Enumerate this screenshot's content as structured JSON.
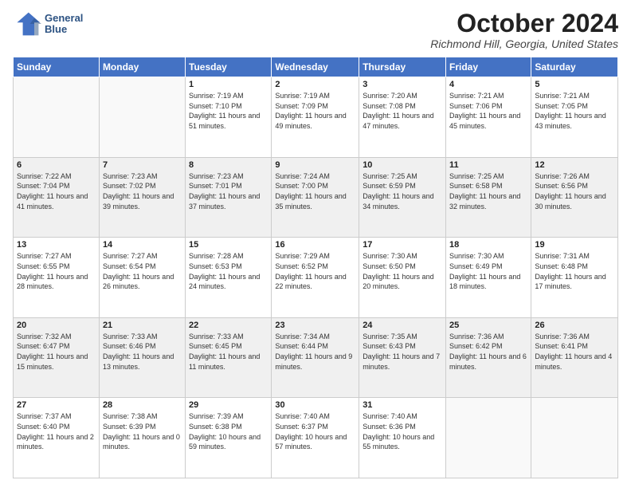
{
  "header": {
    "logo_line1": "General",
    "logo_line2": "Blue",
    "month_title": "October 2024",
    "location": "Richmond Hill, Georgia, United States"
  },
  "days_of_week": [
    "Sunday",
    "Monday",
    "Tuesday",
    "Wednesday",
    "Thursday",
    "Friday",
    "Saturday"
  ],
  "weeks": [
    [
      {
        "num": "",
        "info": ""
      },
      {
        "num": "",
        "info": ""
      },
      {
        "num": "1",
        "info": "Sunrise: 7:19 AM\nSunset: 7:10 PM\nDaylight: 11 hours and 51 minutes."
      },
      {
        "num": "2",
        "info": "Sunrise: 7:19 AM\nSunset: 7:09 PM\nDaylight: 11 hours and 49 minutes."
      },
      {
        "num": "3",
        "info": "Sunrise: 7:20 AM\nSunset: 7:08 PM\nDaylight: 11 hours and 47 minutes."
      },
      {
        "num": "4",
        "info": "Sunrise: 7:21 AM\nSunset: 7:06 PM\nDaylight: 11 hours and 45 minutes."
      },
      {
        "num": "5",
        "info": "Sunrise: 7:21 AM\nSunset: 7:05 PM\nDaylight: 11 hours and 43 minutes."
      }
    ],
    [
      {
        "num": "6",
        "info": "Sunrise: 7:22 AM\nSunset: 7:04 PM\nDaylight: 11 hours and 41 minutes."
      },
      {
        "num": "7",
        "info": "Sunrise: 7:23 AM\nSunset: 7:02 PM\nDaylight: 11 hours and 39 minutes."
      },
      {
        "num": "8",
        "info": "Sunrise: 7:23 AM\nSunset: 7:01 PM\nDaylight: 11 hours and 37 minutes."
      },
      {
        "num": "9",
        "info": "Sunrise: 7:24 AM\nSunset: 7:00 PM\nDaylight: 11 hours and 35 minutes."
      },
      {
        "num": "10",
        "info": "Sunrise: 7:25 AM\nSunset: 6:59 PM\nDaylight: 11 hours and 34 minutes."
      },
      {
        "num": "11",
        "info": "Sunrise: 7:25 AM\nSunset: 6:58 PM\nDaylight: 11 hours and 32 minutes."
      },
      {
        "num": "12",
        "info": "Sunrise: 7:26 AM\nSunset: 6:56 PM\nDaylight: 11 hours and 30 minutes."
      }
    ],
    [
      {
        "num": "13",
        "info": "Sunrise: 7:27 AM\nSunset: 6:55 PM\nDaylight: 11 hours and 28 minutes."
      },
      {
        "num": "14",
        "info": "Sunrise: 7:27 AM\nSunset: 6:54 PM\nDaylight: 11 hours and 26 minutes."
      },
      {
        "num": "15",
        "info": "Sunrise: 7:28 AM\nSunset: 6:53 PM\nDaylight: 11 hours and 24 minutes."
      },
      {
        "num": "16",
        "info": "Sunrise: 7:29 AM\nSunset: 6:52 PM\nDaylight: 11 hours and 22 minutes."
      },
      {
        "num": "17",
        "info": "Sunrise: 7:30 AM\nSunset: 6:50 PM\nDaylight: 11 hours and 20 minutes."
      },
      {
        "num": "18",
        "info": "Sunrise: 7:30 AM\nSunset: 6:49 PM\nDaylight: 11 hours and 18 minutes."
      },
      {
        "num": "19",
        "info": "Sunrise: 7:31 AM\nSunset: 6:48 PM\nDaylight: 11 hours and 17 minutes."
      }
    ],
    [
      {
        "num": "20",
        "info": "Sunrise: 7:32 AM\nSunset: 6:47 PM\nDaylight: 11 hours and 15 minutes."
      },
      {
        "num": "21",
        "info": "Sunrise: 7:33 AM\nSunset: 6:46 PM\nDaylight: 11 hours and 13 minutes."
      },
      {
        "num": "22",
        "info": "Sunrise: 7:33 AM\nSunset: 6:45 PM\nDaylight: 11 hours and 11 minutes."
      },
      {
        "num": "23",
        "info": "Sunrise: 7:34 AM\nSunset: 6:44 PM\nDaylight: 11 hours and 9 minutes."
      },
      {
        "num": "24",
        "info": "Sunrise: 7:35 AM\nSunset: 6:43 PM\nDaylight: 11 hours and 7 minutes."
      },
      {
        "num": "25",
        "info": "Sunrise: 7:36 AM\nSunset: 6:42 PM\nDaylight: 11 hours and 6 minutes."
      },
      {
        "num": "26",
        "info": "Sunrise: 7:36 AM\nSunset: 6:41 PM\nDaylight: 11 hours and 4 minutes."
      }
    ],
    [
      {
        "num": "27",
        "info": "Sunrise: 7:37 AM\nSunset: 6:40 PM\nDaylight: 11 hours and 2 minutes."
      },
      {
        "num": "28",
        "info": "Sunrise: 7:38 AM\nSunset: 6:39 PM\nDaylight: 11 hours and 0 minutes."
      },
      {
        "num": "29",
        "info": "Sunrise: 7:39 AM\nSunset: 6:38 PM\nDaylight: 10 hours and 59 minutes."
      },
      {
        "num": "30",
        "info": "Sunrise: 7:40 AM\nSunset: 6:37 PM\nDaylight: 10 hours and 57 minutes."
      },
      {
        "num": "31",
        "info": "Sunrise: 7:40 AM\nSunset: 6:36 PM\nDaylight: 10 hours and 55 minutes."
      },
      {
        "num": "",
        "info": ""
      },
      {
        "num": "",
        "info": ""
      }
    ]
  ]
}
